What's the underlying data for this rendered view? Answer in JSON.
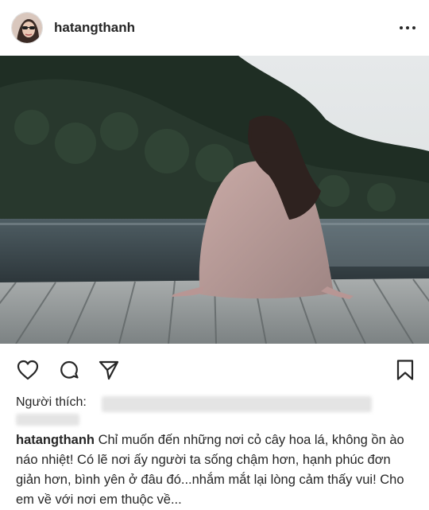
{
  "post": {
    "username": "hatangthanh",
    "likes_label": "Người thích:",
    "caption": "Chỉ muốn đến những nơi cỏ cây hoa lá, không ồn ào náo nhiệt! Có lẽ nơi ấy người ta sống chậm hơn, hạnh phúc đơn giản hơn, bình yên ở đâu đó...nhắm mắt lại lòng cảm thấy vui! Cho em về với nơi em thuộc về..."
  },
  "icons": {
    "more": "more-options-icon",
    "like": "heart-icon",
    "comment": "comment-icon",
    "share": "share-icon",
    "save": "bookmark-icon"
  },
  "colors": {
    "text": "#262626",
    "redacted": "#e4e4e4"
  }
}
